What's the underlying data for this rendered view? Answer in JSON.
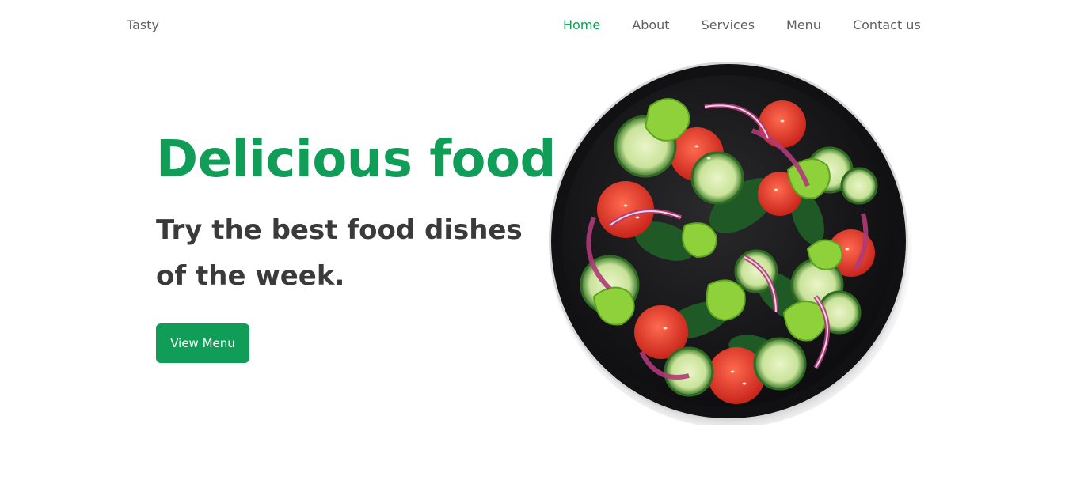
{
  "header": {
    "brand": "Tasty",
    "nav": [
      {
        "label": "Home",
        "active": true
      },
      {
        "label": "About",
        "active": false
      },
      {
        "label": "Services",
        "active": false
      },
      {
        "label": "Menu",
        "active": false
      },
      {
        "label": "Contact us",
        "active": false
      }
    ]
  },
  "hero": {
    "title": "Delicious food",
    "subtitle": "Try the best food dishes of the week.",
    "button_label": "View Menu",
    "image_icon": "salad-plate-image"
  },
  "colors": {
    "accent": "#0f9d58",
    "text_dark": "#3a3a3a",
    "nav_text": "#5f5f5f",
    "background": "#ffffff"
  }
}
